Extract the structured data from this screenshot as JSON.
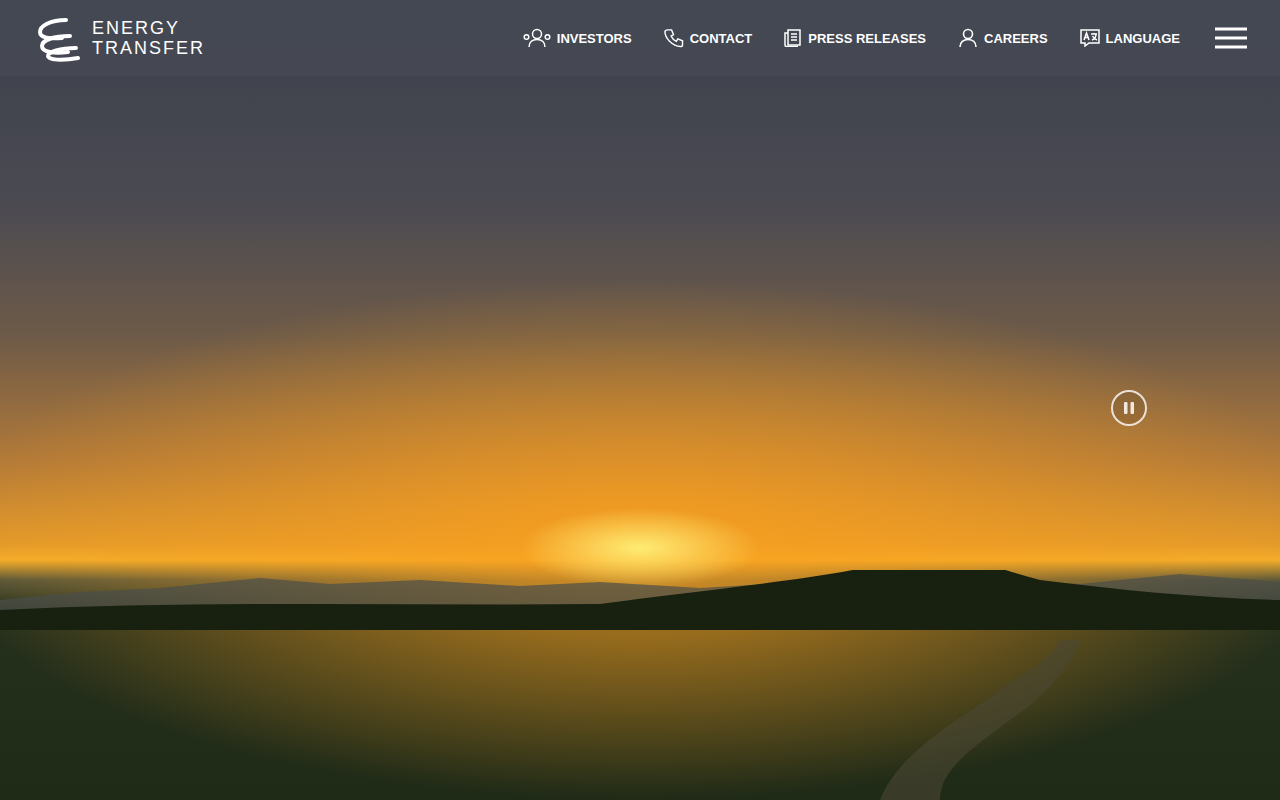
{
  "logo": {
    "line1": "ENERGY",
    "line2": "TRANSFER"
  },
  "nav": [
    {
      "label": "INVESTORS",
      "icon": "investors"
    },
    {
      "label": "CONTACT",
      "icon": "phone"
    },
    {
      "label": "PRESS RELEASES",
      "icon": "document"
    },
    {
      "label": "CAREERS",
      "icon": "person"
    },
    {
      "label": "LANGUAGE",
      "icon": "language"
    }
  ],
  "video": {
    "playing": true
  }
}
